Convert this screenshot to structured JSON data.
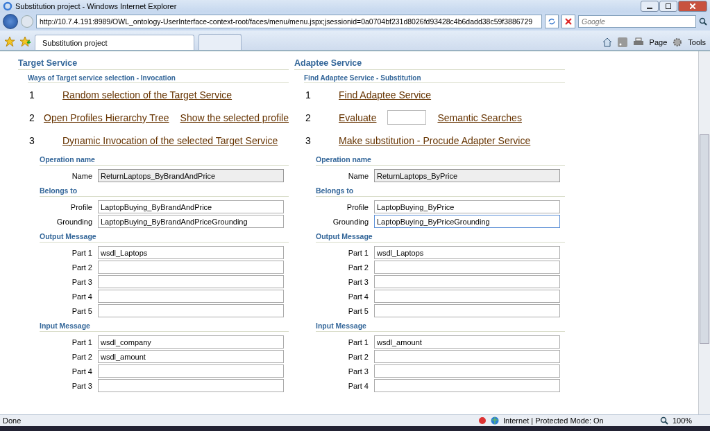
{
  "window": {
    "title": "Substitution project - Windows Internet Explorer"
  },
  "address_bar": {
    "url": "http://10.7.4.191:8989/OWL_ontology-UserInterface-context-root/faces/menu/menu.jspx;jsessionid=0a0704bf231d8026fd93428c4b6dadd38c59f3886729",
    "search_placeholder": "Google"
  },
  "tabs": [
    {
      "label": "Substitution project",
      "selected": true
    }
  ],
  "command_bar": {
    "page": "Page",
    "tools": "Tools"
  },
  "columns": [
    {
      "title": "Target Service",
      "subtitle": "Ways of Target service selection - Invocation",
      "steps": [
        {
          "number": "1",
          "items": [
            {
              "kind": "link",
              "text": "Random selection of the Target Service"
            }
          ]
        },
        {
          "number": "2",
          "items": [
            {
              "kind": "link",
              "text": "Open Profiles Hierarchy Tree"
            },
            {
              "kind": "link",
              "text": "Show the selected profile"
            }
          ]
        },
        {
          "number": "3",
          "items": [
            {
              "kind": "link",
              "text": "Dynamic Invocation of the selected Target Service"
            }
          ]
        }
      ],
      "sections": [
        {
          "title": "Operation name",
          "fields": [
            {
              "label": "Name",
              "value": "ReturnLaptops_ByBrandAndPrice",
              "disabled": true,
              "focused": false
            }
          ]
        },
        {
          "title": "Belongs to",
          "fields": [
            {
              "label": "Profile",
              "value": "LaptopBuying_ByBrandAndPrice",
              "disabled": false,
              "focused": false
            },
            {
              "label": "Grounding",
              "value": "LaptopBuying_ByBrandAndPriceGrounding",
              "disabled": false,
              "focused": false
            }
          ]
        },
        {
          "title": "Output Message",
          "fields": [
            {
              "label": "Part 1",
              "value": "wsdl_Laptops",
              "disabled": false,
              "focused": false
            },
            {
              "label": "Part 2",
              "disabled": false,
              "focused": false
            },
            {
              "label": "Part 3",
              "disabled": false,
              "focused": false
            },
            {
              "label": "Part 4",
              "disabled": false,
              "focused": false
            },
            {
              "label": "Part 5",
              "disabled": false,
              "focused": false
            }
          ]
        },
        {
          "title": "Input Message",
          "fields": [
            {
              "label": "Part 1",
              "value": "wsdl_company",
              "disabled": false,
              "focused": false
            },
            {
              "label": "Part 2",
              "value": "wsdl_amount",
              "disabled": false,
              "focused": false
            },
            {
              "label": "Part 4",
              "disabled": false,
              "focused": false
            },
            {
              "label": "Part 3",
              "disabled": false,
              "focused": false
            }
          ]
        }
      ]
    },
    {
      "title": "Adaptee Service",
      "subtitle": "Find Adaptee Service - Substitution",
      "steps": [
        {
          "number": "1",
          "items": [
            {
              "kind": "link",
              "text": "Find Adaptee Service"
            }
          ]
        },
        {
          "number": "2",
          "items": [
            {
              "kind": "link",
              "text": "Evaluate"
            },
            {
              "kind": "input"
            },
            {
              "kind": "link",
              "text": "Semantic Searches"
            }
          ]
        },
        {
          "number": "3",
          "items": [
            {
              "kind": "link",
              "text": "Make substitution - Procude Adapter Service"
            }
          ]
        }
      ],
      "sections": [
        {
          "title": "Operation name",
          "fields": [
            {
              "label": "Name",
              "value": "ReturnLaptops_ByPrice",
              "disabled": true,
              "focused": false
            }
          ]
        },
        {
          "title": "Belongs to",
          "fields": [
            {
              "label": "Profile",
              "value": "LaptopBuying_ByPrice",
              "disabled": false,
              "focused": false
            },
            {
              "label": "Grounding",
              "value": "LaptopBuying_ByPriceGrounding",
              "disabled": false,
              "focused": true
            }
          ]
        },
        {
          "title": "Output Message",
          "fields": [
            {
              "label": "Part 1",
              "value": "wsdl_Laptops",
              "disabled": false,
              "focused": false
            },
            {
              "label": "Part 2",
              "disabled": false,
              "focused": false
            },
            {
              "label": "Part 3",
              "disabled": false,
              "focused": false
            },
            {
              "label": "Part 4",
              "disabled": false,
              "focused": false
            },
            {
              "label": "Part 5",
              "disabled": false,
              "focused": false
            }
          ]
        },
        {
          "title": "Input Message",
          "fields": [
            {
              "label": "Part 1",
              "value": "wsdl_amount",
              "disabled": false,
              "focused": false
            },
            {
              "label": "Part 2",
              "disabled": false,
              "focused": false
            },
            {
              "label": "Part 3",
              "disabled": false,
              "focused": false
            },
            {
              "label": "Part 4",
              "disabled": false,
              "focused": false
            }
          ]
        }
      ]
    }
  ],
  "status_bar": {
    "text": "Done",
    "zone": "Internet | Protected Mode: On",
    "zoom": "100%"
  }
}
